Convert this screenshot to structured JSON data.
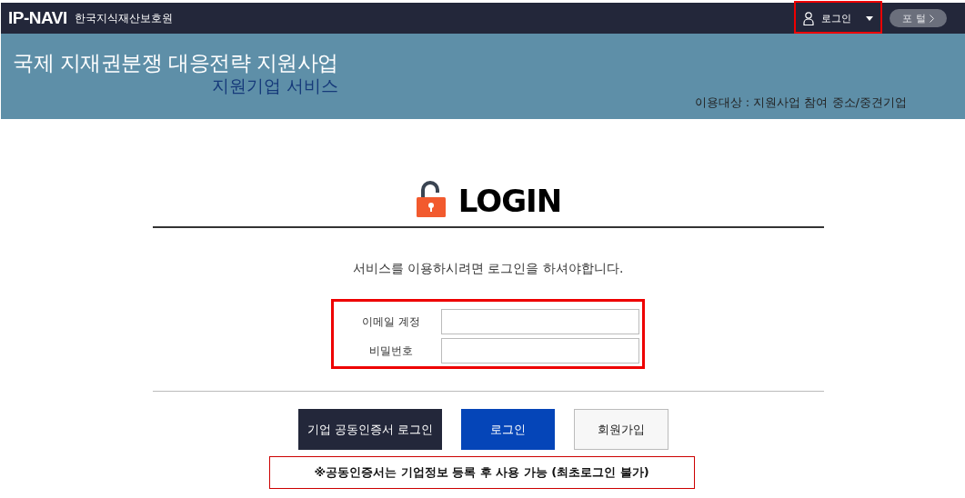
{
  "topbar": {
    "logo": "IP-NAVI",
    "org_name": "한국지식재산보호원",
    "user_menu": "로그인",
    "portal": "포 털"
  },
  "banner": {
    "title": "국제 지재권분쟁 대응전략 지원사업",
    "subtitle": "지원기업 서비스",
    "target": "이용대상 : 지원사업 참여 중소/중견기업"
  },
  "login": {
    "heading": "LOGIN",
    "message": "서비스를 이용하시려면 로그인을 하셔야합니다.",
    "fields": [
      {
        "label": "이메일 계정"
      },
      {
        "label": "비밀번호"
      }
    ],
    "buttons": [
      {
        "label": "기업 공동인증서 로그인",
        "kind": "dark"
      },
      {
        "label": "로그인",
        "kind": "primary"
      },
      {
        "label": "회원가입",
        "kind": "plain"
      }
    ],
    "notice": "※공동인증서는 기업정보 등록 후 사용 가능 (최초로그인 불가)"
  }
}
